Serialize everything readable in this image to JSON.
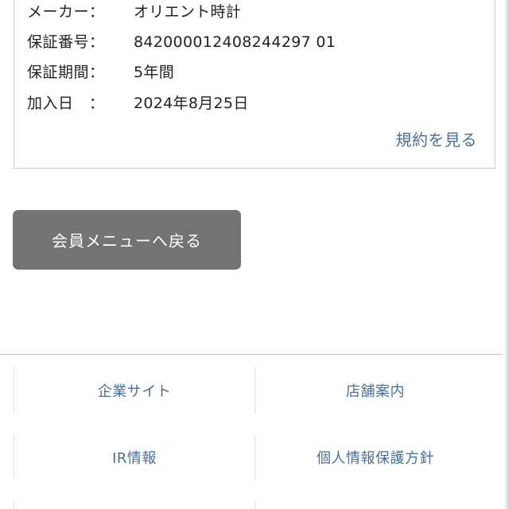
{
  "warranty": {
    "rows": [
      {
        "key": "メーカー：",
        "value": "オリエント時計"
      },
      {
        "key": "保証番号：",
        "value": "842000012408244297 01"
      },
      {
        "key": "保証期間：",
        "value": "5年間"
      },
      {
        "key": "加入日　：",
        "value": "2024年8月25日"
      }
    ],
    "terms_link": "規約を見る"
  },
  "back_button_label": "会員メニューへ戻る",
  "footer": {
    "links": [
      "企業サイト",
      "店舗案内",
      "IR情報",
      "個人情報保護方針"
    ]
  },
  "colors": {
    "link": "#4a6f95",
    "button_bg": "#737373",
    "border": "#cfcfcf"
  }
}
